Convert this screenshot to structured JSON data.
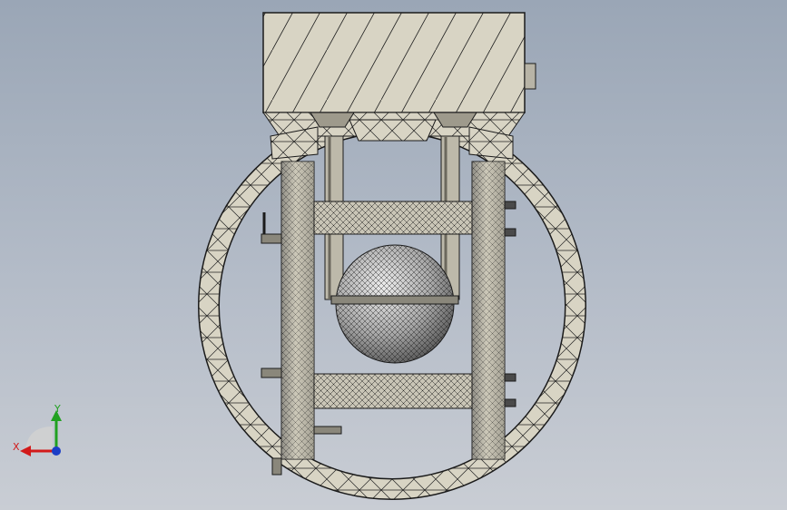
{
  "triad": {
    "x_label": "X",
    "y_label": "Y",
    "colors": {
      "x": "#d21a1a",
      "y": "#21a121",
      "z": "#1c3ec7"
    }
  },
  "model": {
    "colors": {
      "face": "#d8d4c4",
      "face_dark": "#9e9a8c",
      "edge": "#1b1b1b",
      "sphere_light": "#ececec",
      "sphere_dark": "#4a4a4a"
    }
  }
}
